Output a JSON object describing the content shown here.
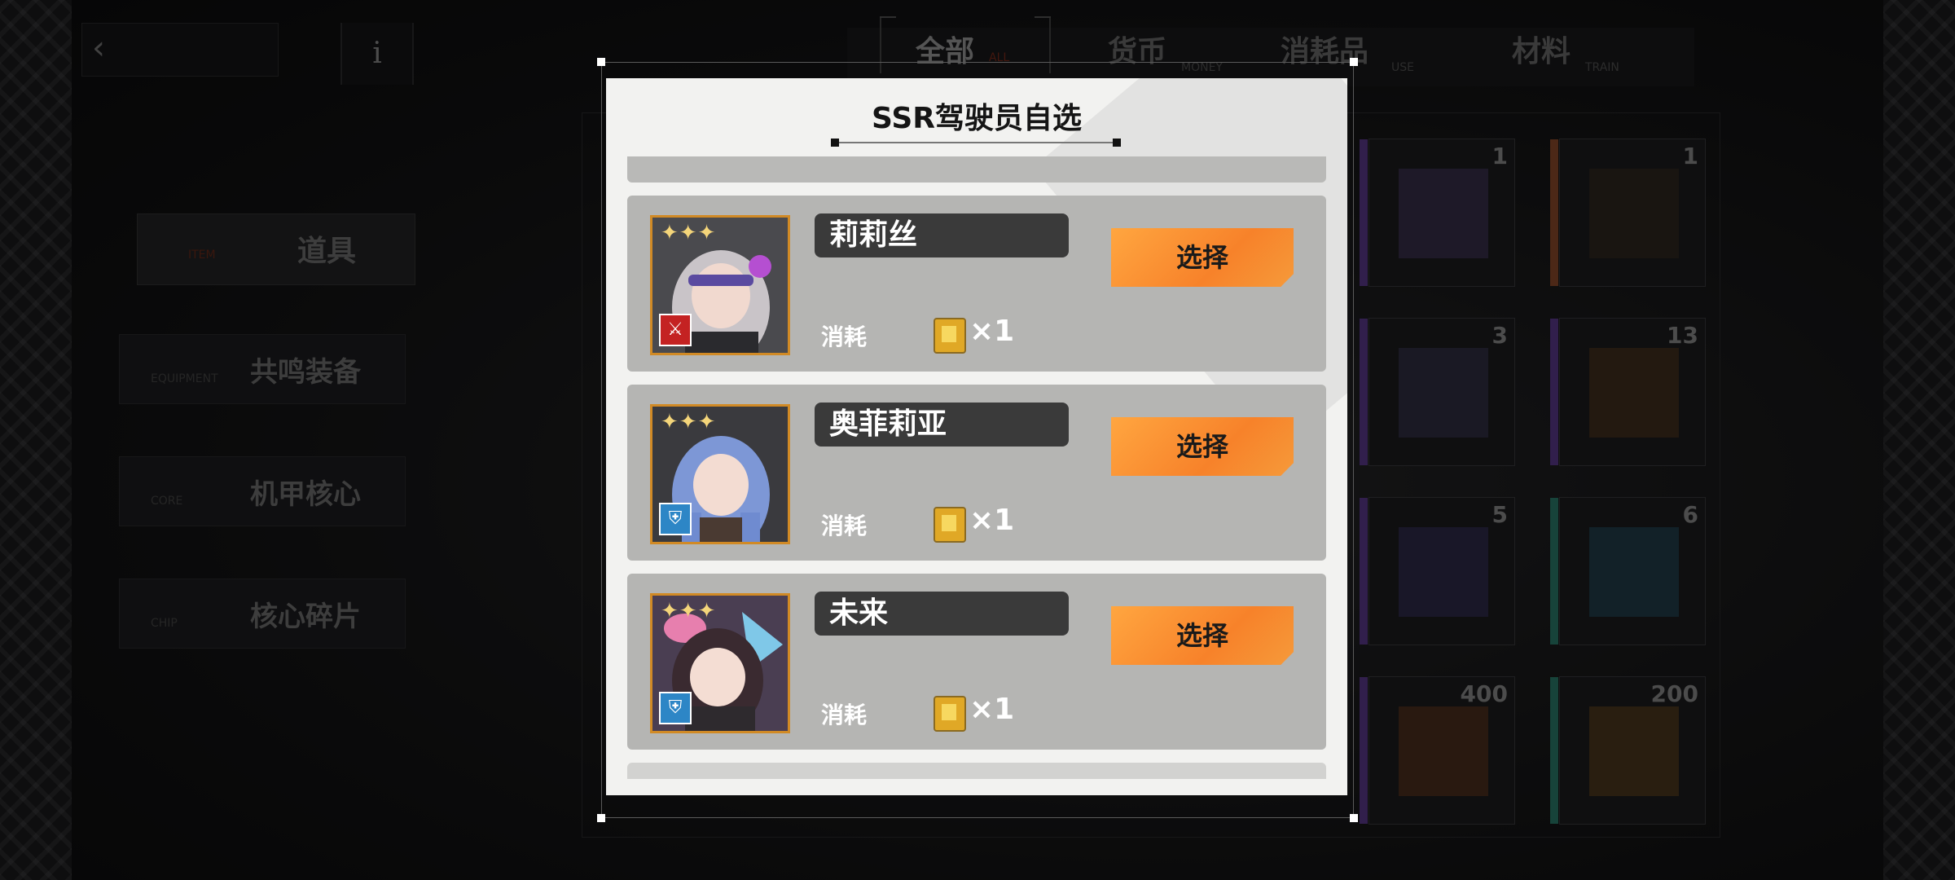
{
  "topbar": {
    "info_label": "i",
    "tabs": [
      {
        "cn": "全部",
        "en": "ALL",
        "active": true
      },
      {
        "cn": "货币",
        "en": "MONEY",
        "active": false
      },
      {
        "cn": "消耗品",
        "en": "USE",
        "active": false
      },
      {
        "cn": "材料",
        "en": "TRAIN",
        "active": false
      }
    ]
  },
  "sidebar": {
    "header": {
      "cn": "道具",
      "en": "ITEM"
    },
    "items": [
      {
        "cn": "共鸣装备",
        "en": "EQUIPMENT"
      },
      {
        "cn": "机甲核心",
        "en": "CORE"
      },
      {
        "cn": "核心碎片",
        "en": "CHIP"
      }
    ]
  },
  "inventory": {
    "counts": [
      "1",
      "1",
      "3",
      "13",
      "5",
      "6",
      "400",
      "200"
    ]
  },
  "dialog": {
    "title": "SSR驾驶员自选",
    "cost_label": "消耗",
    "quantity": "×1",
    "select_label": "选择",
    "stars": "✦✦✦",
    "pilots": [
      {
        "name": "莉莉丝",
        "class_icon": "sword-class-icon",
        "class_color": "#c42222",
        "class_glyph": "⚔"
      },
      {
        "name": "奥菲莉亚",
        "class_icon": "shield-class-icon",
        "class_color": "#2d86c6",
        "class_glyph": "⛨"
      },
      {
        "name": "未来",
        "class_icon": "shield-class-icon",
        "class_color": "#2d86c6",
        "class_glyph": "⛨"
      }
    ]
  },
  "colors": {
    "accent_orange": "#f7822a",
    "portrait_border": "#d18a25"
  }
}
